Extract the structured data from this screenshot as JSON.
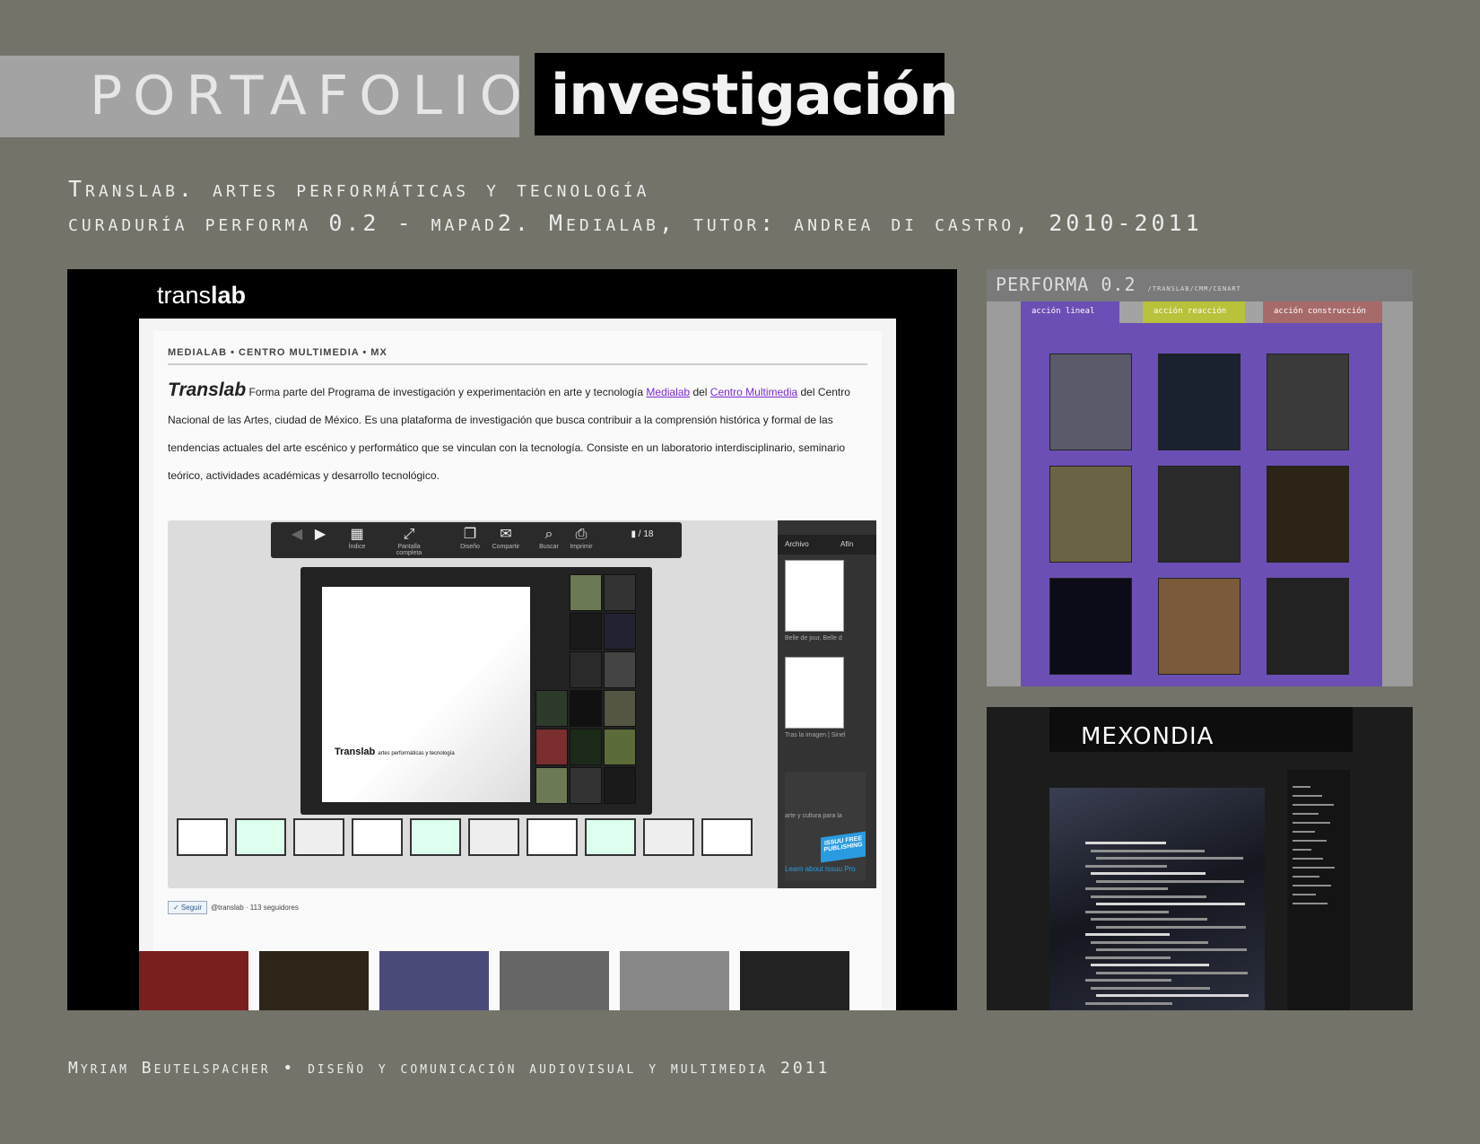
{
  "header": {
    "left_title": "PORTAFOLIO",
    "right_title": "investigación"
  },
  "subtitle": {
    "line1": "Translab. artes performáticas y tecnología",
    "line2": "curaduría performa 0.2 - mapad2. Medialab, tutor: andrea di castro, 2010-2011"
  },
  "translab": {
    "logo_light": "trans",
    "logo_bold": "lab",
    "crumb": "MEDIALAB • CENTRO MULTIMEDIA • MX",
    "intro_brand": "Translab",
    "intro_p1": " Forma parte del Programa de investigación y experimentación en arte y tecnología ",
    "link_medialab": "Medialab",
    "intro_del": " del ",
    "link_centro": "Centro Multimedia",
    "intro_p2": " del Centro Nacional de las Artes, ciudad de México. Es una plataforma de investigación que busca contribuir a la comprensión histórica y formal de las tendencias actuales del arte escénico y performático que se vinculan con la tecnología. Consiste en un laboratorio interdisciplinario, seminario teórico, actividades académicas y desarrollo tecnológico.",
    "viewer": {
      "toolbar": [
        {
          "icon": "grid-icon",
          "glyph": "▦",
          "label": "Índice"
        },
        {
          "icon": "fullscreen-icon",
          "glyph": "⤢",
          "label": "Pantalla completa"
        },
        {
          "icon": "layers-icon",
          "glyph": "❐",
          "label": "Diseño"
        },
        {
          "icon": "mail-icon",
          "glyph": "✉",
          "label": "Compartir"
        },
        {
          "icon": "search-icon",
          "glyph": "⌕",
          "label": "Buscar"
        },
        {
          "icon": "print-icon",
          "glyph": "⎙",
          "label": "Imprimir"
        }
      ],
      "page_indicator": "/ 18",
      "doc_title": "Translab",
      "doc_subtitle": "artes performáticas y tecnología",
      "side_tab_1": "Archivo",
      "side_tab_2": "Afín",
      "side_cap_1": "Belle de jour, Belle d",
      "side_cap_2": "Tras la imagen | Sinel",
      "side_cap_3": "arte y cultura para la",
      "issuu_badge": "ISSUU FREE PUBLISHING",
      "issuu_learn": "Learn about Issuu Pro",
      "follow_button": "✓ Seguir",
      "follow_text": "@translab · 113 seguidores"
    }
  },
  "performa": {
    "title": "PERFORMA 0.2",
    "path": "/TRANSLAB/CMM/CENART",
    "tabs": [
      "acción lineal",
      "acción reacción",
      "acción construcción"
    ],
    "tab_colors": [
      "#6b4fb4",
      "#b8c23a",
      "#a76a6a"
    ]
  },
  "medialab": {
    "logo": "MEXONDIA"
  },
  "footer": "Myriam Beutelspacher • diseño y comunicación audiovisual y multimedia 2011"
}
